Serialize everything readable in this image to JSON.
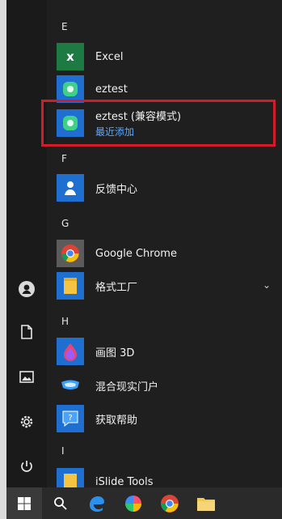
{
  "sections": {
    "e": "E",
    "f": "F",
    "g": "G",
    "h": "H",
    "i": "I"
  },
  "apps": {
    "excel": "Excel",
    "eztest": "eztest",
    "eztest_compat": "eztest (兼容模式)",
    "eztest_compat_sub": "最近添加",
    "feedback": "反馈中心",
    "chrome": "Google Chrome",
    "format_factory": "格式工厂",
    "paint3d": "画图 3D",
    "mixed_reality": "混合现实门户",
    "get_help": "获取帮助",
    "islide": "iSlide Tools"
  },
  "icons": {
    "excel_letter": "x",
    "help_glyph": "?"
  },
  "colors": {
    "menu_bg": "#1f1f1f",
    "accent_blue": "#5ea8ff",
    "highlight_red": "#d21c2a",
    "excel_green": "#1d7a43",
    "tile_blue": "#1f6fd1"
  }
}
